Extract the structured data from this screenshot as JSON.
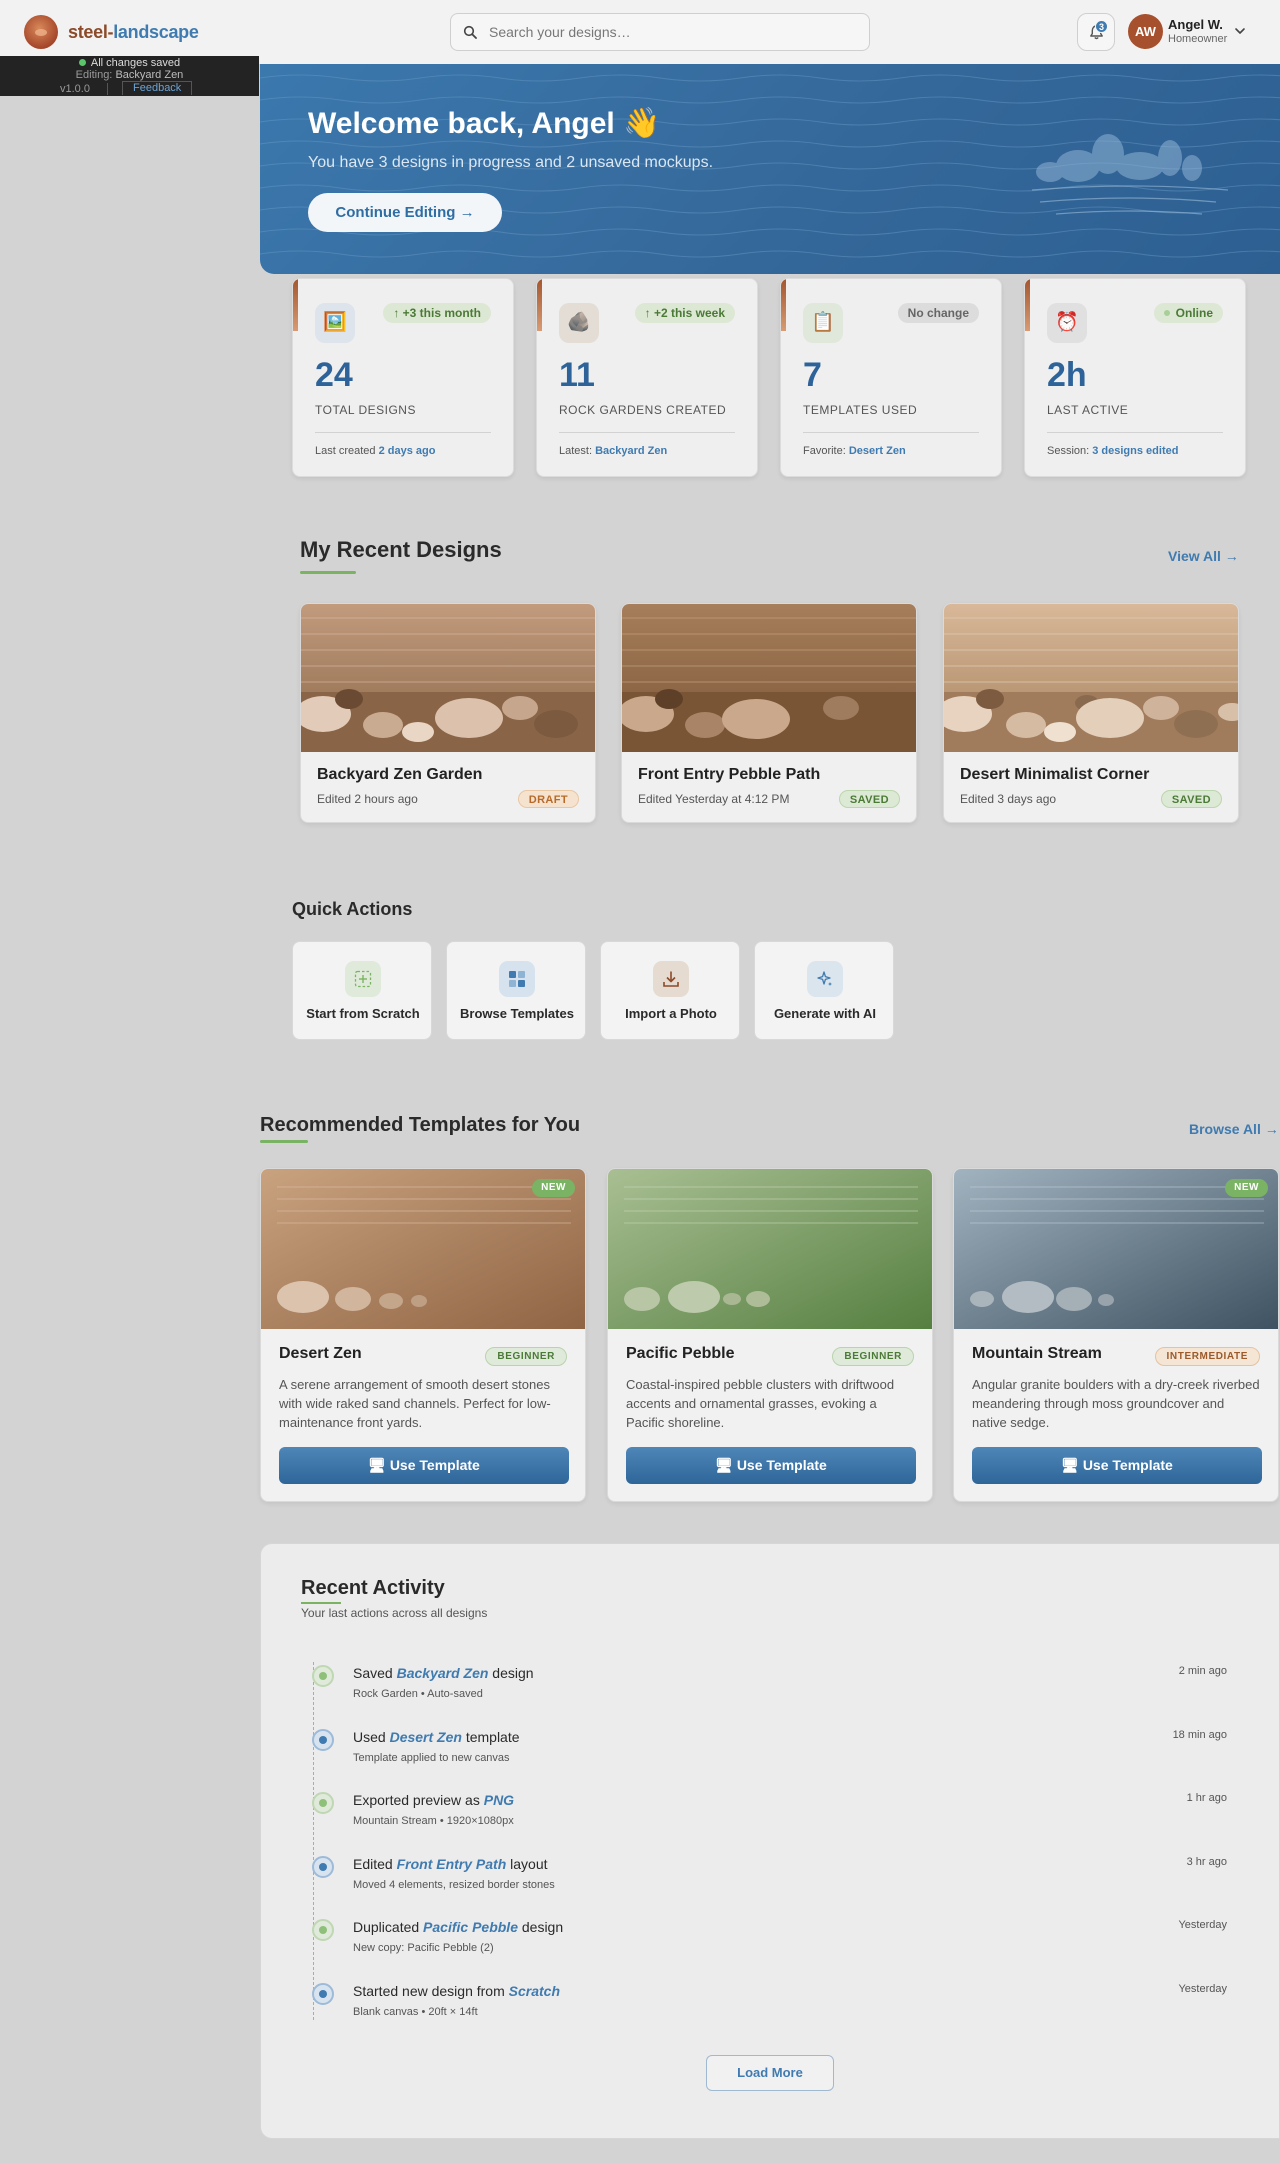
{
  "brand": {
    "part1": "steel-",
    "part2": "landscape"
  },
  "search": {
    "placeholder": "Search your designs…",
    "value": ""
  },
  "notifications": {
    "count": "3"
  },
  "user": {
    "initials": "AW",
    "name": "Angel W.",
    "role": "Homeowner"
  },
  "statusbar": {
    "saved": "All changes saved",
    "editing_label": "Editing:",
    "editing_value": "Backyard Zen",
    "version": "v1.0.0",
    "feedback": "Feedback"
  },
  "hero": {
    "title": "Welcome back, Angel 👋",
    "subtitle": "You have 3 designs in progress and 2 unsaved mockups.",
    "cta": "Continue Editing  →"
  },
  "stats": [
    {
      "icon": "image-icon",
      "glyph": "🖼️",
      "badge": "+3 this month",
      "value": "24",
      "label": "TOTAL DESIGNS",
      "foot_prefix": "Last created ",
      "foot_value": "2 days ago"
    },
    {
      "icon": "rock-icon",
      "glyph": "🪨",
      "badge": "+2 this week",
      "value": "11",
      "label": "ROCK GARDENS CREATED",
      "foot_prefix": "Latest: ",
      "foot_value": "Backyard Zen"
    },
    {
      "icon": "clipboard-icon",
      "glyph": "📋",
      "badge": "No change",
      "value": "7",
      "label": "TEMPLATES USED",
      "foot_prefix": "Favorite: ",
      "foot_value": "Desert Zen"
    },
    {
      "icon": "alarm-clock-icon",
      "glyph": "⏰",
      "badge": "Online",
      "value": "2h",
      "label": "LAST ACTIVE",
      "foot_prefix": "Session: ",
      "foot_value": "3 designs edited"
    }
  ],
  "recent": {
    "title": "My Recent Designs",
    "view_all": "View All →",
    "items": [
      {
        "title": "Backyard Zen Garden",
        "meta": "Edited 2 hours ago",
        "status": "DRAFT"
      },
      {
        "title": "Front Entry Pebble Path",
        "meta": "Edited Yesterday at 4:12 PM",
        "status": "SAVED"
      },
      {
        "title": "Desert Minimalist Corner",
        "meta": "Edited 3 days ago",
        "status": "SAVED"
      }
    ]
  },
  "quick_actions": {
    "title": "Quick Actions",
    "items": [
      {
        "label": "Start from Scratch",
        "icon": "add-canvas-icon"
      },
      {
        "label": "Browse Templates",
        "icon": "grid-icon"
      },
      {
        "label": "Import a Photo",
        "icon": "download-icon"
      },
      {
        "label": "Generate with AI",
        "icon": "sparkle-icon"
      }
    ]
  },
  "templates": {
    "title": "Recommended Templates for You",
    "browse_all": "Browse All →",
    "items": [
      {
        "badge": "NEW",
        "title": "Desert Zen",
        "level": "BEGINNER",
        "desc": "A serene arrangement of smooth desert stones with wide raked sand channels. Perfect for low-maintenance front yards.",
        "cta": "🖥 Use Template"
      },
      {
        "badge": "",
        "title": "Pacific Pebble",
        "level": "BEGINNER",
        "desc": "Coastal-inspired pebble clusters with driftwood accents and ornamental grasses, evoking a Pacific shoreline.",
        "cta": "🖥 Use Template"
      },
      {
        "badge": "NEW",
        "title": "Mountain Stream",
        "level": "INTERMEDIATE",
        "desc": "Angular granite boulders with a dry-creek riverbed meandering through moss groundcover and native sedge.",
        "cta": "🖥 Use Template"
      }
    ]
  },
  "activity": {
    "title": "Recent Activity",
    "subtitle": "Your last actions across all designs",
    "load_more": "Load More",
    "items": [
      {
        "pre": "Saved ",
        "em": "Backyard Zen",
        "post": " design",
        "sub": "Rock Garden • Auto-saved",
        "time": "2 min ago",
        "tone": "green"
      },
      {
        "pre": "Used ",
        "em": "Desert Zen",
        "post": " template",
        "sub": "Template applied to new canvas",
        "time": "18 min ago",
        "tone": "blue"
      },
      {
        "pre": "Exported preview as ",
        "em": "PNG",
        "post": "",
        "sub": "Mountain Stream • 1920×1080px",
        "time": "1 hr ago",
        "tone": "green"
      },
      {
        "pre": "Edited ",
        "em": "Front Entry Path",
        "post": " layout",
        "sub": "Moved 4 elements, resized border stones",
        "time": "3 hr ago",
        "tone": "blue"
      },
      {
        "pre": "Duplicated ",
        "em": "Pacific Pebble",
        "post": " design",
        "sub": "New copy: Pacific Pebble (2)",
        "time": "Yesterday",
        "tone": "green"
      },
      {
        "pre": "Started new design from ",
        "em": "Scratch",
        "post": "",
        "sub": "Blank canvas • 20ft × 14ft",
        "time": "Yesterday",
        "tone": "blue"
      }
    ]
  }
}
